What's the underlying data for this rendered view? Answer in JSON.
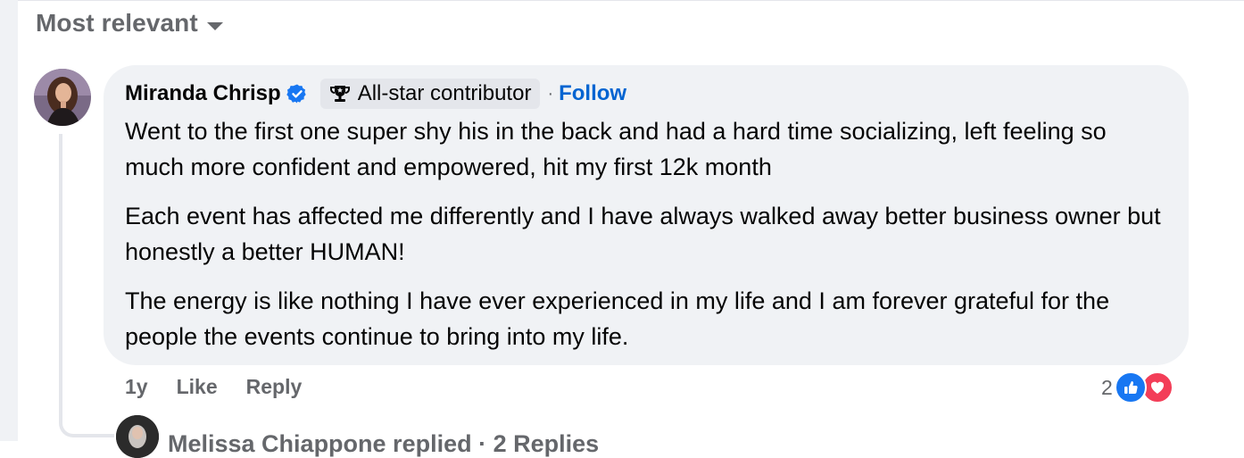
{
  "sort": {
    "label": "Most relevant",
    "icon": "caret-down-icon"
  },
  "comment": {
    "author": "Miranda Chrisp",
    "verified_icon": "verified-badge-icon",
    "badge": {
      "icon": "trophy-icon",
      "label": "All-star contributor"
    },
    "separator": "·",
    "follow_label": "Follow",
    "paragraphs": [
      "Went to the first one super shy his in the back and had a hard time socializing, left feeling so much more confident and empowered, hit my first 12k month",
      "Each event has affected me differently and I have always walked away better business owner but honestly a better HUMAN!",
      "The energy is like nothing I have ever experienced in my life and I am forever grateful for the people the events continue to bring into my life."
    ],
    "time": "1y",
    "like_label": "Like",
    "reply_label": "Reply",
    "reaction_count": "2",
    "reactions": [
      "like-icon",
      "love-icon"
    ]
  },
  "reply_summary": {
    "text": "Melissa Chiappone replied · 2 Replies"
  },
  "colors": {
    "accent": "#0064d1",
    "like": "#1877f2",
    "love": "#f33e58",
    "bubble": "#f0f2f5",
    "muted_text": "#65676b"
  }
}
